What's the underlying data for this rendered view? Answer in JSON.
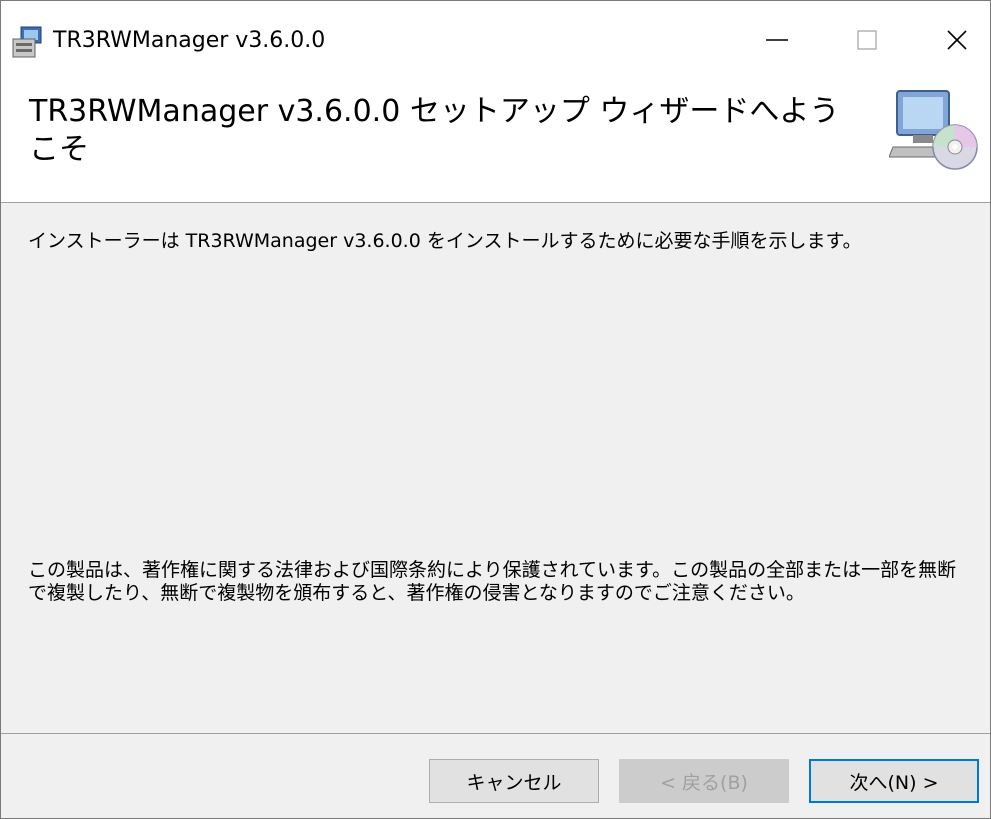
{
  "window": {
    "title": "TR3RWManager v3.6.0.0",
    "controls": {
      "minimize": "—",
      "maximize": "□",
      "close": "✕"
    }
  },
  "header": {
    "title": "TR3RWManager v3.6.0.0 セットアップ ウィザードへようこそ",
    "icon": "computer-cd-icon"
  },
  "content": {
    "intro": "インストーラーは TR3RWManager v3.6.0.0 をインストールするために必要な手順を示します。",
    "copyright_notice": "この製品は、著作権に関する法律および国際条約により保護されています。この製品の全部または一部を無断で複製したり、無断で複製物を頒布すると、著作権の侵害となりますのでご注意ください。"
  },
  "buttons": {
    "cancel": "キャンセル",
    "back": "< 戻る(B)",
    "next": "次へ(N) >"
  }
}
